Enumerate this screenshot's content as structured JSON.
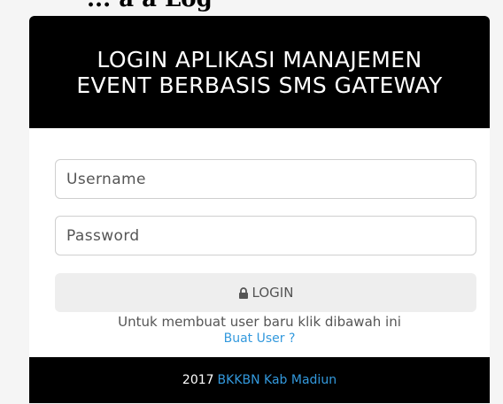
{
  "cropped_caption": "... a a Log",
  "panel": {
    "title_line1": "LOGIN APLIKASI MANAJEMEN",
    "title_line2": "EVENT BERBASIS SMS GATEWAY"
  },
  "form": {
    "username_placeholder": "Username",
    "password_placeholder": "Password",
    "login_label": "LOGIN",
    "login_icon": "lock-icon",
    "help_text": "Untuk membuat user baru klik dibawah ini",
    "register_link": "Buat User ?"
  },
  "footer": {
    "year": "2017",
    "org_link": "BKKBN Kab Madiun"
  },
  "colors": {
    "header_bg": "#000000",
    "link": "#3399dd",
    "button_bg": "#eeeeee"
  }
}
